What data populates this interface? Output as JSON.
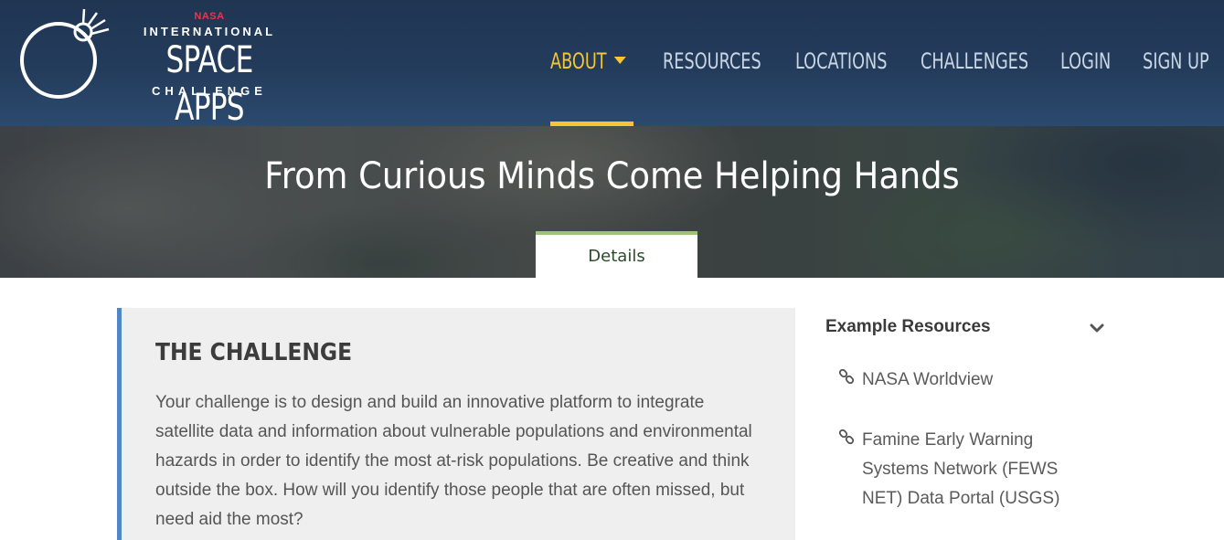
{
  "logo": {
    "nasa": "NASA",
    "line1": "INTERNATIONAL",
    "line2": "SPACE APPS",
    "line3": "CHALLENGE",
    "icon": "planet-orbit-icon"
  },
  "nav": {
    "items": [
      {
        "label": "ABOUT",
        "active": true,
        "has_dropdown": true
      },
      {
        "label": "RESOURCES"
      },
      {
        "label": "LOCATIONS"
      },
      {
        "label": "CHALLENGES"
      },
      {
        "label": "LOGIN"
      },
      {
        "label": "SIGN UP"
      }
    ]
  },
  "hero": {
    "title": "From Curious Minds Come Helping Hands",
    "tab": "Details"
  },
  "challenge": {
    "heading": "THE CHALLENGE",
    "body": "Your challenge is to design and build an innovative platform to integrate satellite data and information about vulnerable populations and environmental hazards in order to identify the most at-risk populations. Be creative and think outside the box. How will you identify those people that are often missed, but need aid the most?"
  },
  "sidebar": {
    "title": "Example Resources",
    "toggle_icon": "chevron-down-icon",
    "resources": [
      {
        "label": "NASA Worldview",
        "icon": "link-icon"
      },
      {
        "label": "Famine Early Warning Systems Network (FEWS NET) Data Portal (USGS)",
        "icon": "link-icon"
      }
    ]
  },
  "colors": {
    "header_bg": "#243c5c",
    "nav_text": "#c9d6e4",
    "accent_yellow": "#f5c532",
    "nasa_red": "#e8384a",
    "tab_border_green": "#9ec27a",
    "quote_border_blue": "#4f86c6"
  }
}
